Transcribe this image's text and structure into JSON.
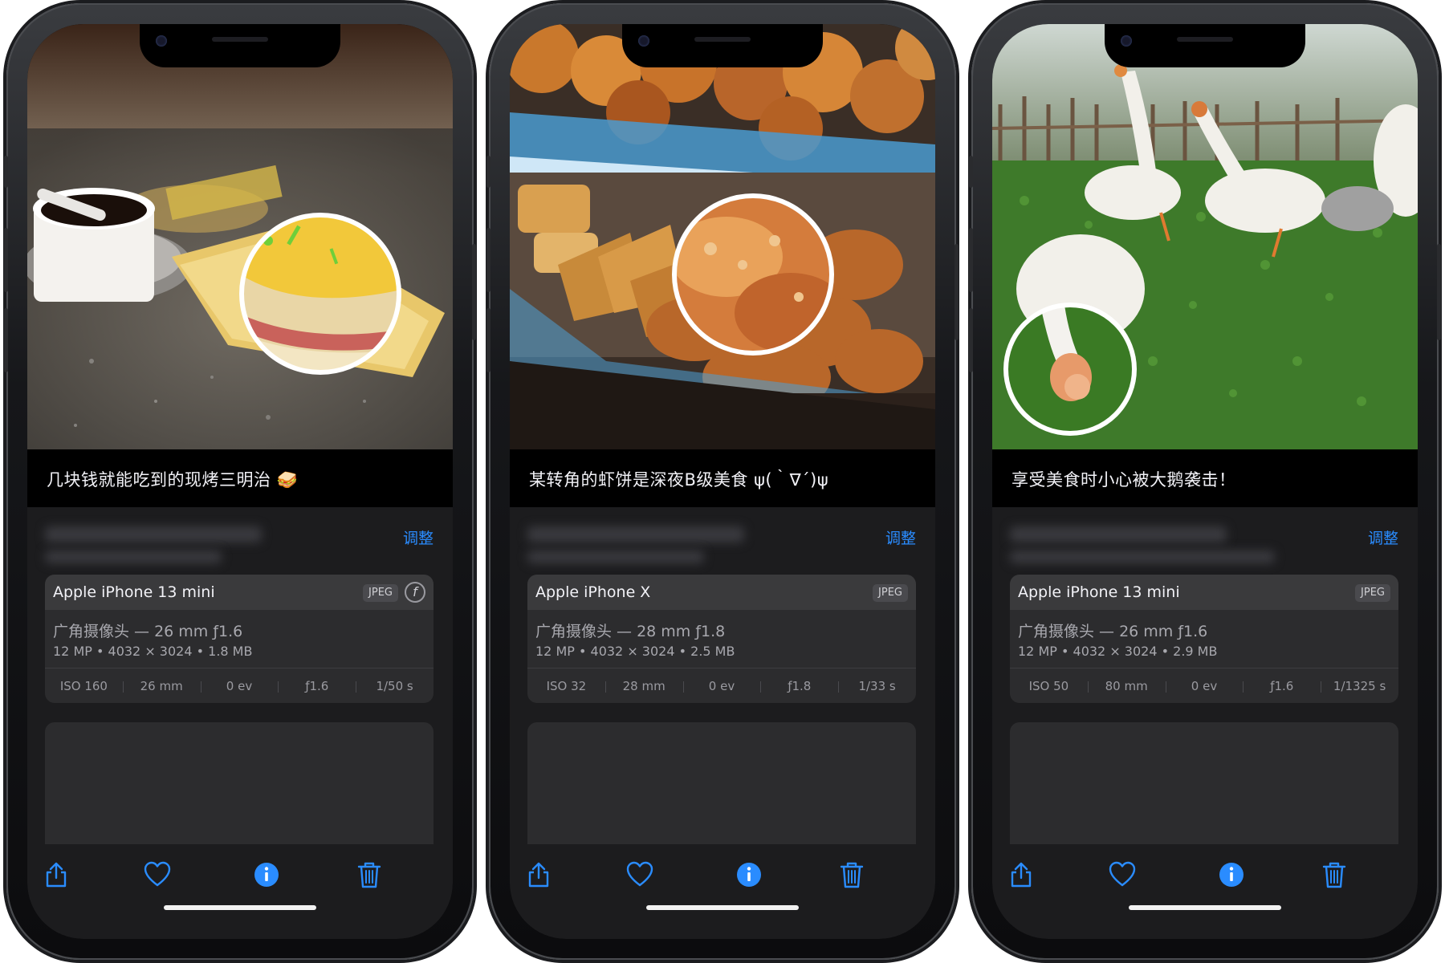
{
  "accent": "#2a8cff",
  "phones": [
    {
      "caption": "几块钱就能吃到的现烤三明治 🥪",
      "adjust": "调整",
      "camera": {
        "model": "Apple iPhone 13 mini",
        "format": "JPEG",
        "lens": "广角摄像头 — 26 mm ƒ1.6",
        "specs": "12 MP  •  4032 × 3024  •  1.8 MB",
        "exif": [
          "ISO 160",
          "26 mm",
          "0 ev",
          "ƒ1.6",
          "1/50 s"
        ]
      },
      "photo_subject": "sandwich",
      "toolbar_icons": [
        "share-icon",
        "heart-icon",
        "info-icon",
        "trash-icon"
      ]
    },
    {
      "caption": "某转角的虾饼是深夜B级美食 ψ(｀∇´)ψ",
      "adjust": "调整",
      "camera": {
        "model": "Apple iPhone X",
        "format": "JPEG",
        "lens": "广角摄像头 — 28 mm ƒ1.8",
        "specs": "12 MP  •  4032 × 3024  •  2.5 MB",
        "exif": [
          "ISO 32",
          "28 mm",
          "0 ev",
          "ƒ1.8",
          "1/33 s"
        ]
      },
      "photo_subject": "shrimp-cakes",
      "toolbar_icons": [
        "share-icon",
        "heart-icon",
        "info-icon",
        "trash-icon"
      ]
    },
    {
      "caption": "享受美食时小心被大鹅袭击！",
      "adjust": "调整",
      "camera": {
        "model": "Apple iPhone 13 mini",
        "format": "JPEG",
        "lens": "广角摄像头 — 26 mm ƒ1.6",
        "specs": "12 MP  •  4032 × 3024  •  2.9 MB",
        "exif": [
          "ISO 50",
          "80 mm",
          "0 ev",
          "ƒ1.6",
          "1/1325 s"
        ]
      },
      "photo_subject": "geese",
      "toolbar_icons": [
        "share-icon",
        "heart-icon",
        "info-icon",
        "trash-icon"
      ]
    }
  ]
}
